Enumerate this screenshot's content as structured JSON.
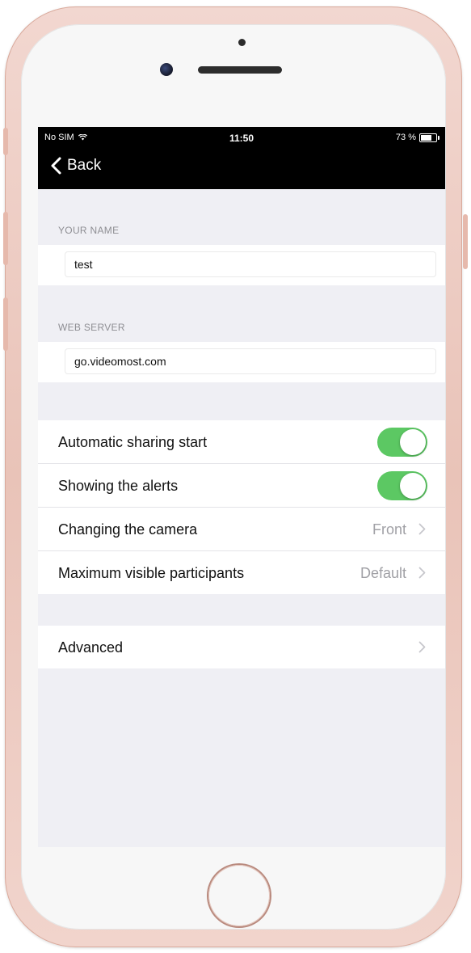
{
  "status_bar": {
    "carrier": "No SIM",
    "wifi_icon": "wifi-icon",
    "time": "11:50",
    "battery_percent": "73 %",
    "battery_level": 0.73
  },
  "nav": {
    "back_label": "Back"
  },
  "name_section": {
    "header": "YOUR NAME",
    "value": "test"
  },
  "server_section": {
    "header": "WEB SERVER",
    "value": "go.videomost.com"
  },
  "settings": {
    "rows": [
      {
        "label": "Automatic sharing start",
        "type": "toggle",
        "on": true
      },
      {
        "label": "Showing the alerts",
        "type": "toggle",
        "on": true
      },
      {
        "label": "Changing the camera",
        "type": "value",
        "value": "Front"
      },
      {
        "label": "Maximum visible participants",
        "type": "value",
        "value": "Default"
      }
    ]
  },
  "advanced": {
    "label": "Advanced"
  },
  "colors": {
    "toggle_on": "#5cc863",
    "background": "#efeff4",
    "nav_bar": "#000000",
    "phone_body": "#eac6bc"
  }
}
